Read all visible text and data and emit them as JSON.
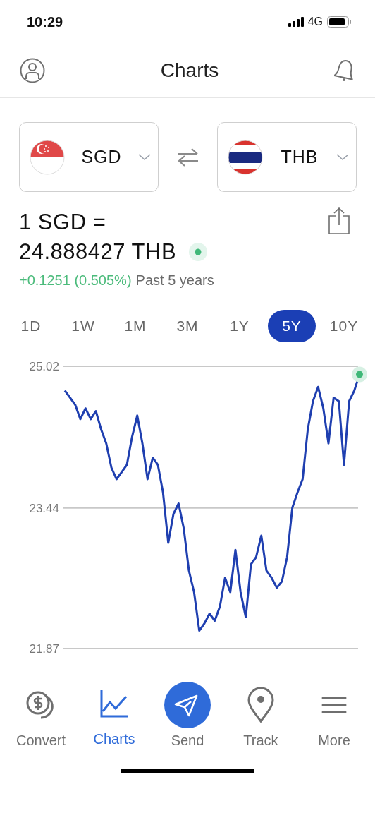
{
  "status_bar": {
    "time": "10:29",
    "network": "4G"
  },
  "header": {
    "title": "Charts"
  },
  "selectors": [
    {
      "code": "SGD",
      "kind": "sg"
    },
    {
      "code": "THB",
      "kind": "th"
    }
  ],
  "rate": {
    "line_1": "1 SGD =",
    "line_2": "24.888427 THB",
    "change": "+0.1251 (0.505%)",
    "period": "Past 5 years"
  },
  "periods": [
    {
      "label": "1D",
      "selected": false
    },
    {
      "label": "1W",
      "selected": false
    },
    {
      "label": "1M",
      "selected": false
    },
    {
      "label": "3M",
      "selected": false
    },
    {
      "label": "1Y",
      "selected": false
    },
    {
      "label": "5Y",
      "selected": true
    },
    {
      "label": "10Y",
      "selected": false
    }
  ],
  "chart_data": {
    "type": "line",
    "ylim": [
      21.87,
      25.02
    ],
    "yticks": [
      25.02,
      23.44,
      21.87
    ],
    "series": [
      {
        "color": "#1f3fb0",
        "values": [
          24.75,
          24.67,
          24.59,
          24.43,
          24.55,
          24.43,
          24.52,
          24.32,
          24.16,
          23.89,
          23.76,
          23.84,
          23.92,
          24.23,
          24.47,
          24.16,
          23.76,
          24.0,
          23.92,
          23.61,
          23.05,
          23.37,
          23.49,
          23.21,
          22.74,
          22.5,
          22.07,
          22.15,
          22.26,
          22.18,
          22.34,
          22.66,
          22.5,
          22.97,
          22.5,
          22.22,
          22.81,
          22.89,
          23.13,
          22.74,
          22.66,
          22.55,
          22.62,
          22.89,
          23.44,
          23.61,
          23.76,
          24.32,
          24.63,
          24.79,
          24.55,
          24.16,
          24.67,
          24.63,
          23.92,
          24.63,
          24.75,
          24.93
        ]
      }
    ]
  },
  "nav": [
    {
      "label": "Convert",
      "kind": "coins",
      "selected": false
    },
    {
      "label": "Charts",
      "kind": "chart",
      "selected": true
    },
    {
      "label": "Send",
      "kind": "send",
      "selected": false
    },
    {
      "label": "Track",
      "kind": "pin",
      "selected": false
    },
    {
      "label": "More",
      "kind": "menu",
      "selected": false
    }
  ]
}
